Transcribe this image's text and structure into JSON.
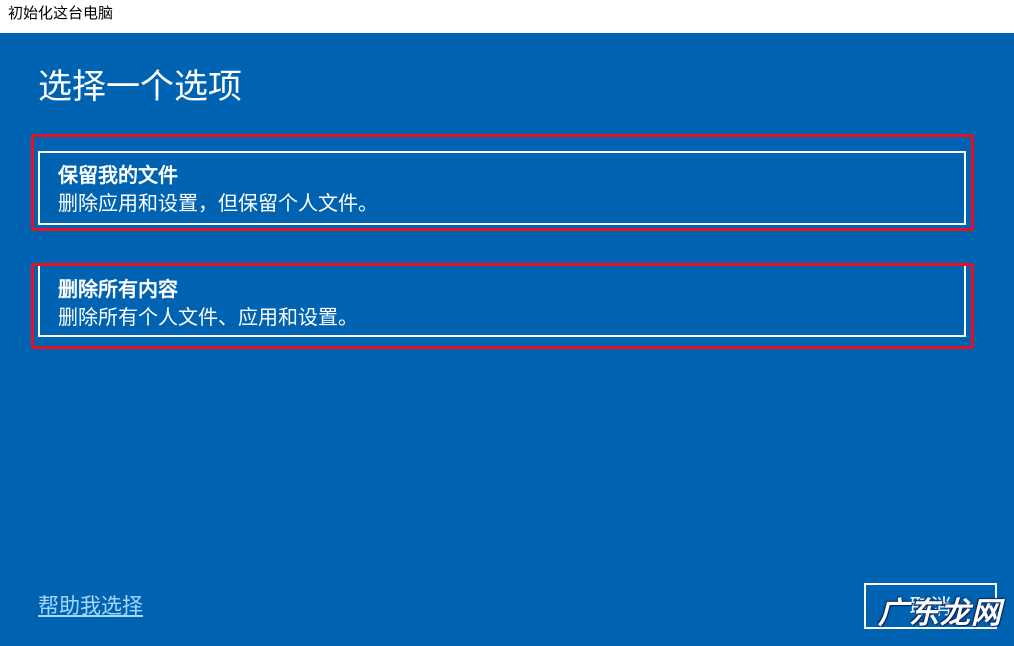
{
  "window": {
    "title": "初始化这台电脑"
  },
  "page": {
    "heading": "选择一个选项"
  },
  "options": [
    {
      "title": "保留我的文件",
      "description": "删除应用和设置，但保留个人文件。"
    },
    {
      "title": "删除所有内容",
      "description": "删除所有个人文件、应用和设置。"
    }
  ],
  "footer": {
    "help_link": "帮助我选择",
    "cancel_label": "取消"
  },
  "watermark": "广东龙网",
  "colors": {
    "background": "#0063b1",
    "text": "#ffffff",
    "link": "#a6d8ff",
    "highlight": "#e81123"
  }
}
